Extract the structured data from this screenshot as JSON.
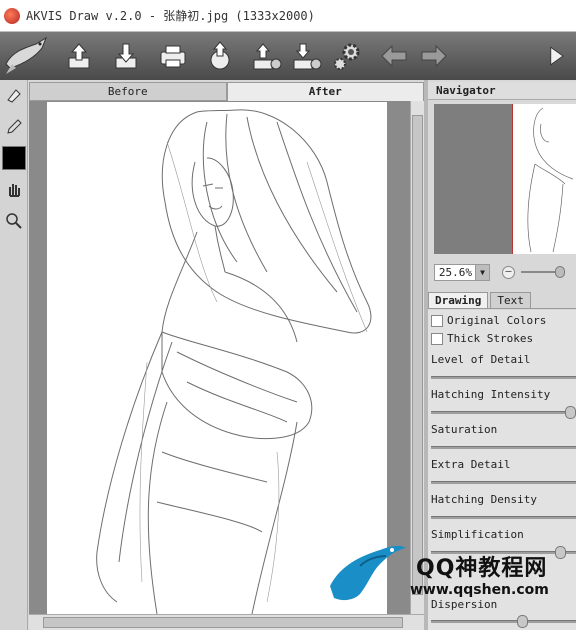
{
  "window": {
    "title": "AKVIS Draw v.2.0 - 张静初.jpg (1333x2000)"
  },
  "toolbar": {
    "buttons": [
      {
        "name": "open-icon"
      },
      {
        "name": "save-icon"
      },
      {
        "name": "print-icon"
      },
      {
        "name": "share-icon"
      },
      {
        "name": "batch-upload-icon"
      },
      {
        "name": "batch-download-icon"
      },
      {
        "name": "settings-gear-icon"
      },
      {
        "name": "undo-arrow-icon"
      },
      {
        "name": "redo-arrow-icon"
      },
      {
        "name": "run-icon"
      }
    ]
  },
  "view_tabs": {
    "before": "Before",
    "after": "After",
    "active": "after"
  },
  "navigator": {
    "title": "Navigator",
    "zoom": "25.6%"
  },
  "settings_tabs": {
    "drawing": "Drawing",
    "text": "Text",
    "active": "drawing"
  },
  "settings": {
    "original_colors": "Original Colors",
    "thick_strokes": "Thick Strokes",
    "level_of_detail": "Level of Detail",
    "hatching_intensity": "Hatching Intensity",
    "saturation": "Saturation",
    "extra_detail": "Extra Detail",
    "hatching_density": "Hatching Density",
    "simplification": "Simplification",
    "dispersion": "Dispersion",
    "slider_values": {
      "level_of_detail": null,
      "hatching_intensity": 0.95,
      "saturation": null,
      "extra_detail": null,
      "hatching_density": null,
      "simplification": 0.88,
      "dispersion": 0.6
    }
  },
  "watermark": {
    "line1": "QQ神教程网",
    "line2": "www.qqshen.com"
  },
  "colors": {
    "toolbar": "#5a5a5a",
    "drawing_color": "#000000"
  }
}
